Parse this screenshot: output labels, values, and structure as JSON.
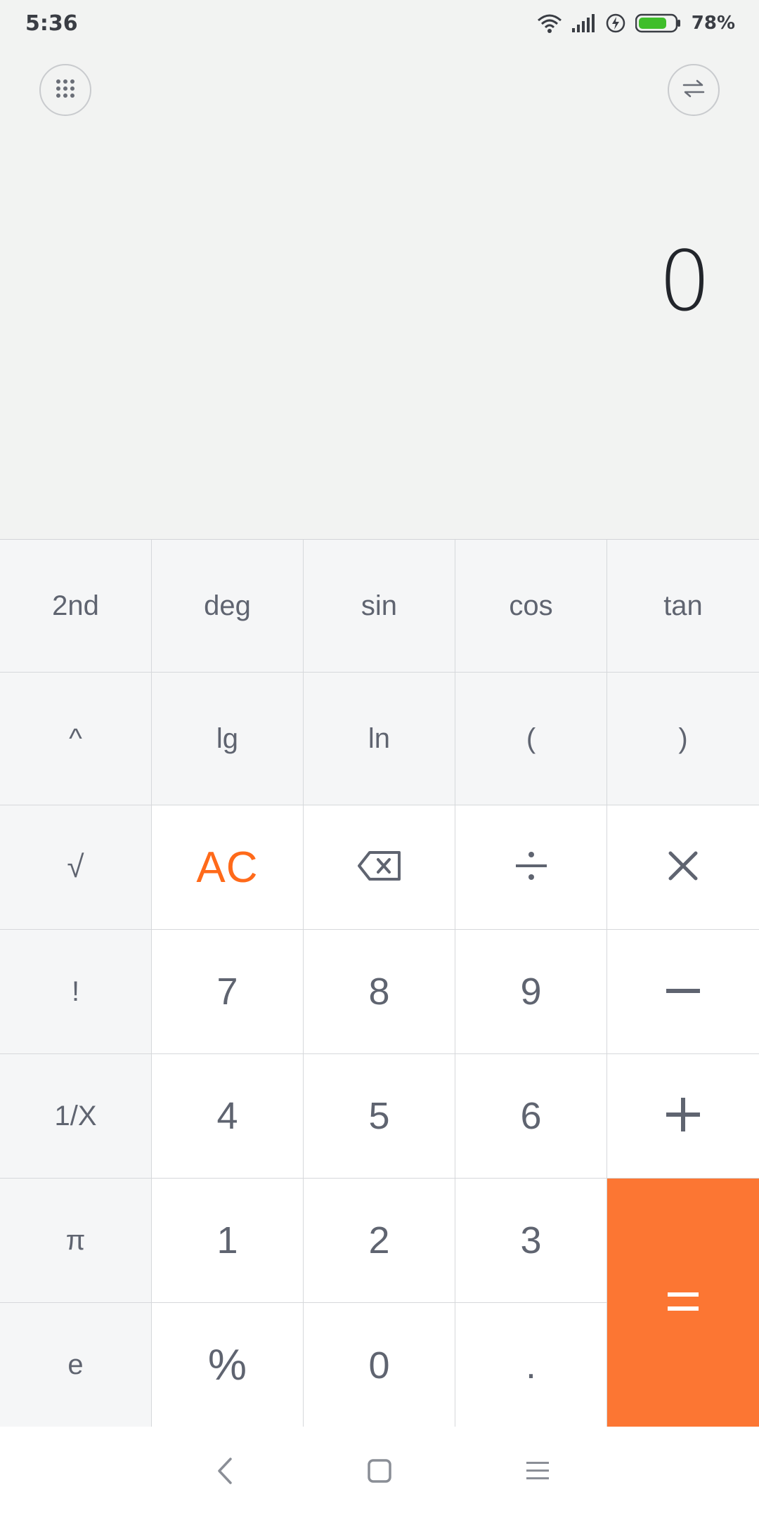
{
  "status_bar": {
    "time": "5:36",
    "battery_percent": "78%",
    "battery_level": 0.78,
    "battery_color": "#3fbe2a"
  },
  "toolbar": {
    "menu_icon": "grid-dots-icon",
    "convert_icon": "swap-arrows-icon"
  },
  "display": {
    "value": "0"
  },
  "keys": {
    "second": "2nd",
    "deg": "deg",
    "sin": "sin",
    "cos": "cos",
    "tan": "tan",
    "power": "^",
    "lg": "lg",
    "ln": "ln",
    "lparen": "(",
    "rparen": ")",
    "sqrt": "√",
    "ac": "AC",
    "backspace_icon": "backspace-icon",
    "divide_icon": "divide-icon",
    "multiply_icon": "multiply-icon",
    "factorial": "!",
    "seven": "7",
    "eight": "8",
    "nine": "9",
    "minus_icon": "minus-icon",
    "reciprocal": "1/X",
    "four": "4",
    "five": "5",
    "six": "6",
    "plus_icon": "plus-icon",
    "pi": "π",
    "one": "1",
    "two": "2",
    "three": "3",
    "equals_icon": "equals-icon",
    "e": "e",
    "percent": "%",
    "zero": "0",
    "decimal": "."
  },
  "colors": {
    "accent_orange": "#fc7633",
    "ac_text": "#ff6a1a",
    "sci_key_bg": "#f5f6f7",
    "num_key_bg": "#ffffff",
    "display_text": "#22252b"
  },
  "nav_bar": {
    "back_icon": "back-chevron-icon",
    "home_icon": "home-square-icon",
    "menu_icon": "recents-menu-icon"
  }
}
